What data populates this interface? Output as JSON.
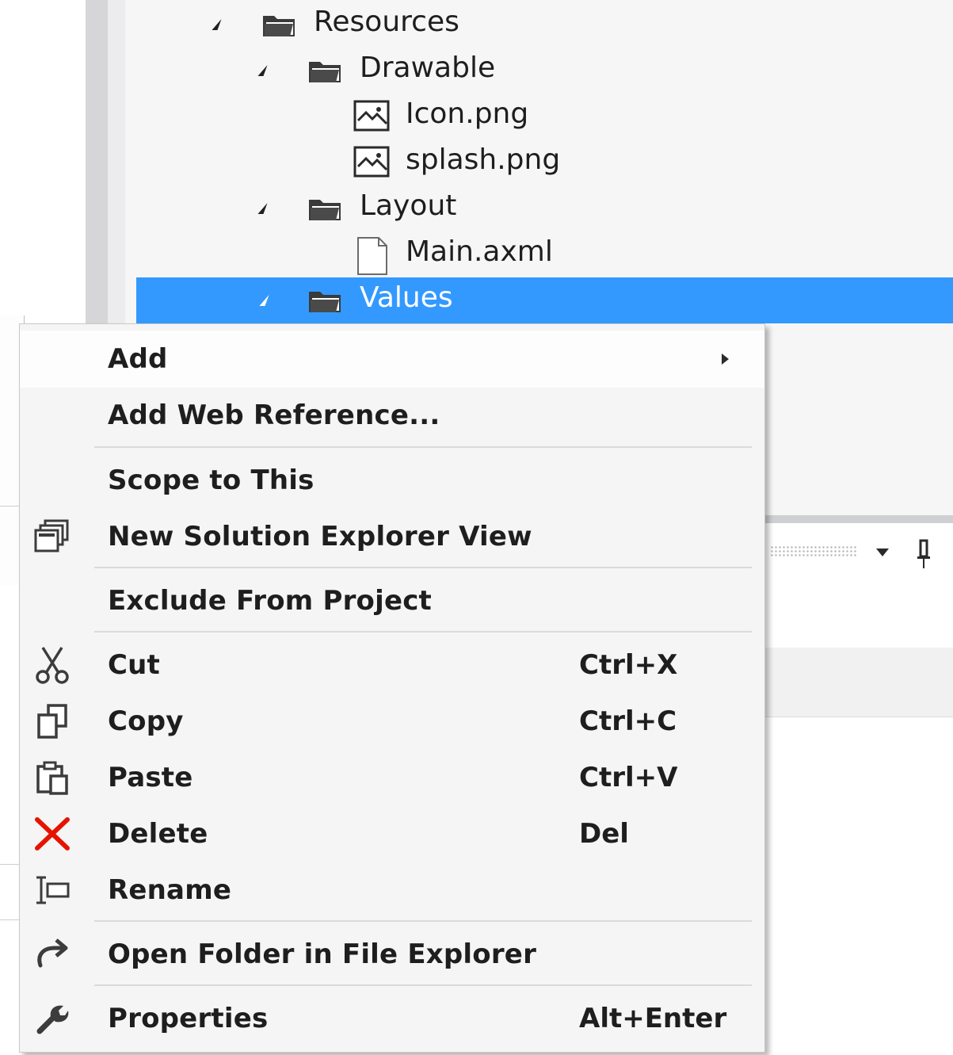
{
  "tree": {
    "items": [
      {
        "label": "Resources",
        "kind": "folder",
        "expanded": true
      },
      {
        "label": "Drawable",
        "kind": "folder",
        "expanded": true
      },
      {
        "label": "Icon.png",
        "kind": "image-file"
      },
      {
        "label": "splash.png",
        "kind": "image-file"
      },
      {
        "label": "Layout",
        "kind": "folder",
        "expanded": true
      },
      {
        "label": "Main.axml",
        "kind": "file"
      },
      {
        "label": "Values",
        "kind": "folder",
        "expanded": true,
        "selected": true
      }
    ],
    "selection_color": "#3399ff"
  },
  "context_menu": {
    "items": [
      {
        "label": "Add",
        "shortcut": "",
        "icon": "",
        "submenu": true
      },
      {
        "label": "Add Web Reference...",
        "shortcut": "",
        "icon": ""
      },
      {
        "label": "Scope to This",
        "shortcut": "",
        "icon": ""
      },
      {
        "label": "New Solution Explorer View",
        "shortcut": "",
        "icon": "new-view-icon"
      },
      {
        "label": "Exclude From Project",
        "shortcut": "",
        "icon": ""
      },
      {
        "label": "Cut",
        "shortcut": "Ctrl+X",
        "icon": "scissors-icon"
      },
      {
        "label": "Copy",
        "shortcut": "Ctrl+C",
        "icon": "copy-icon"
      },
      {
        "label": "Paste",
        "shortcut": "Ctrl+V",
        "icon": "paste-icon"
      },
      {
        "label": "Delete",
        "shortcut": "Del",
        "icon": "delete-x-icon"
      },
      {
        "label": "Rename",
        "shortcut": "",
        "icon": "rename-icon"
      },
      {
        "label": "Open Folder in File Explorer",
        "shortcut": "",
        "icon": "open-folder-arrow-icon"
      },
      {
        "label": "Properties",
        "shortcut": "Alt+Enter",
        "icon": "wrench-icon"
      }
    ],
    "delete_icon_color": "#e51400"
  }
}
